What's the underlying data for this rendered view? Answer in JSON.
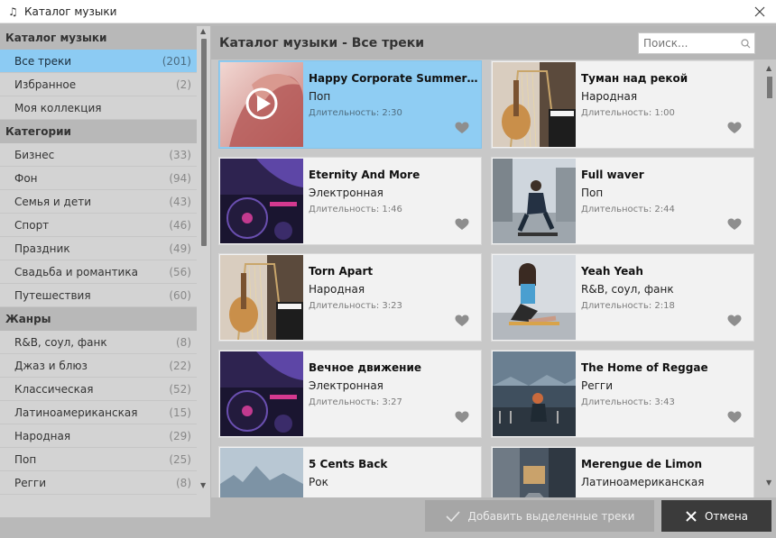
{
  "window": {
    "title": "Каталог музыки",
    "note_icon": "♫"
  },
  "sidebar": {
    "sections": [
      {
        "title": "Каталог музыки",
        "items": [
          {
            "label": "Все треки",
            "count": "(201)",
            "active": true
          },
          {
            "label": "Избранное",
            "count": "(2)"
          },
          {
            "label": "Моя коллекция",
            "count": ""
          }
        ]
      },
      {
        "title": "Категории",
        "items": [
          {
            "label": "Бизнес",
            "count": "(33)"
          },
          {
            "label": "Фон",
            "count": "(94)"
          },
          {
            "label": "Семья и дети",
            "count": "(43)"
          },
          {
            "label": "Спорт",
            "count": "(46)"
          },
          {
            "label": "Праздник",
            "count": "(49)"
          },
          {
            "label": "Свадьба и романтика",
            "count": "(56)"
          },
          {
            "label": "Путешествия",
            "count": "(60)"
          }
        ]
      },
      {
        "title": "Жанры",
        "items": [
          {
            "label": "R&B, соул, фанк",
            "count": "(8)"
          },
          {
            "label": "Джаз и блюз",
            "count": "(22)"
          },
          {
            "label": "Классическая",
            "count": "(52)"
          },
          {
            "label": "Латиноамериканская",
            "count": "(15)"
          },
          {
            "label": "Народная",
            "count": "(29)"
          },
          {
            "label": "Поп",
            "count": "(25)"
          },
          {
            "label": "Регги",
            "count": "(8)"
          }
        ]
      }
    ]
  },
  "main": {
    "title": "Каталог музыки - Все треки",
    "search_placeholder": "Поиск...",
    "tracks": [
      {
        "title": "Happy Corporate Summer Jo...",
        "genre": "Поп",
        "duration": "Длительность: 2:30",
        "selected": true,
        "thumb": "girl"
      },
      {
        "title": "Туман над рекой",
        "genre": "Народная",
        "duration": "Длительность: 1:00",
        "thumb": "instruments"
      },
      {
        "title": "Eternity And More",
        "genre": "Электронная",
        "duration": "Длительность: 1:46",
        "thumb": "dj"
      },
      {
        "title": "Full waver",
        "genre": "Поп",
        "duration": "Длительность: 2:44",
        "thumb": "skater"
      },
      {
        "title": "Torn Apart",
        "genre": "Народная",
        "duration": "Длительность: 3:23",
        "thumb": "instruments"
      },
      {
        "title": "Yeah Yeah",
        "genre": "R&B, соул, фанк",
        "duration": "Длительность: 2:18",
        "thumb": "woman"
      },
      {
        "title": "Вечное движение",
        "genre": "Электронная",
        "duration": "Длительность: 3:27",
        "thumb": "dj"
      },
      {
        "title": "The Home of Reggae",
        "genre": "Регги",
        "duration": "Длительность: 3:43",
        "thumb": "reggae"
      },
      {
        "title": "5 Cents Back",
        "genre": "Рок",
        "duration": "",
        "thumb": "city"
      },
      {
        "title": "Merengue de Limon",
        "genre": "Латиноамериканская",
        "duration": "",
        "thumb": "street"
      }
    ]
  },
  "buttons": {
    "add_label": "Добавить выделенные треки",
    "cancel_label": "Отмена"
  },
  "colors": {
    "selection": "#8fcdf3",
    "cancel_bg": "#3b3b3b",
    "add_bg": "#a6a6a6"
  }
}
